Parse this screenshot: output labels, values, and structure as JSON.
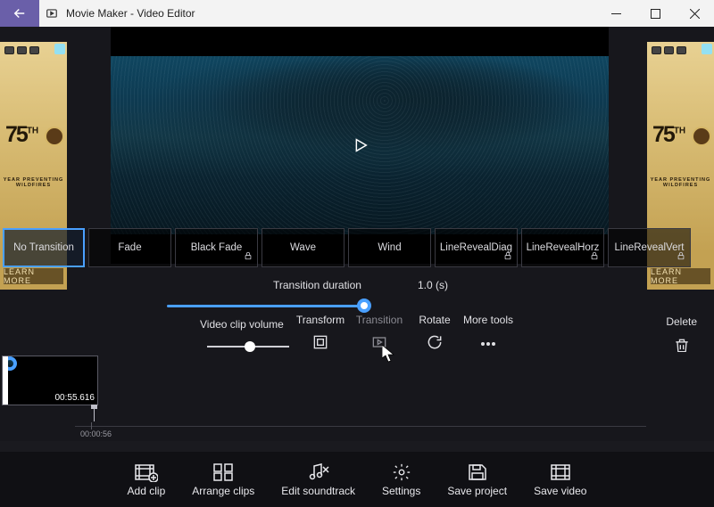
{
  "titlebar": {
    "title": "Movie Maker - Video Editor"
  },
  "ad": {
    "logo_num": "75",
    "logo_suffix": "TH",
    "tagline": "YEAR PREVENTING WILDFIRES",
    "cta": "LEARN MORE"
  },
  "transitions": {
    "items": [
      {
        "label": "No Transition",
        "selected": true,
        "locked": false
      },
      {
        "label": "Fade",
        "selected": false,
        "locked": false
      },
      {
        "label": "Black Fade",
        "selected": false,
        "locked": true
      },
      {
        "label": "Wave",
        "selected": false,
        "locked": false
      },
      {
        "label": "Wind",
        "selected": false,
        "locked": false
      },
      {
        "label": "LineRevealDiag",
        "selected": false,
        "locked": true
      },
      {
        "label": "LineRevealHorz",
        "selected": false,
        "locked": true
      },
      {
        "label": "LineRevealVert",
        "selected": false,
        "locked": true
      }
    ],
    "duration_label": "Transition duration",
    "duration_value": "1.0 (s)"
  },
  "tools": {
    "volume_label": "Video clip volume",
    "transform": "Transform",
    "transition": "Transition",
    "rotate": "Rotate",
    "more": "More tools",
    "delete": "Delete"
  },
  "timeline": {
    "clip_duration": "00:55.616",
    "tick_0": "00:00:56"
  },
  "commands": {
    "add_clip": "Add clip",
    "arrange": "Arrange clips",
    "soundtrack": "Edit soundtrack",
    "settings": "Settings",
    "save_project": "Save project",
    "save_video": "Save video"
  }
}
